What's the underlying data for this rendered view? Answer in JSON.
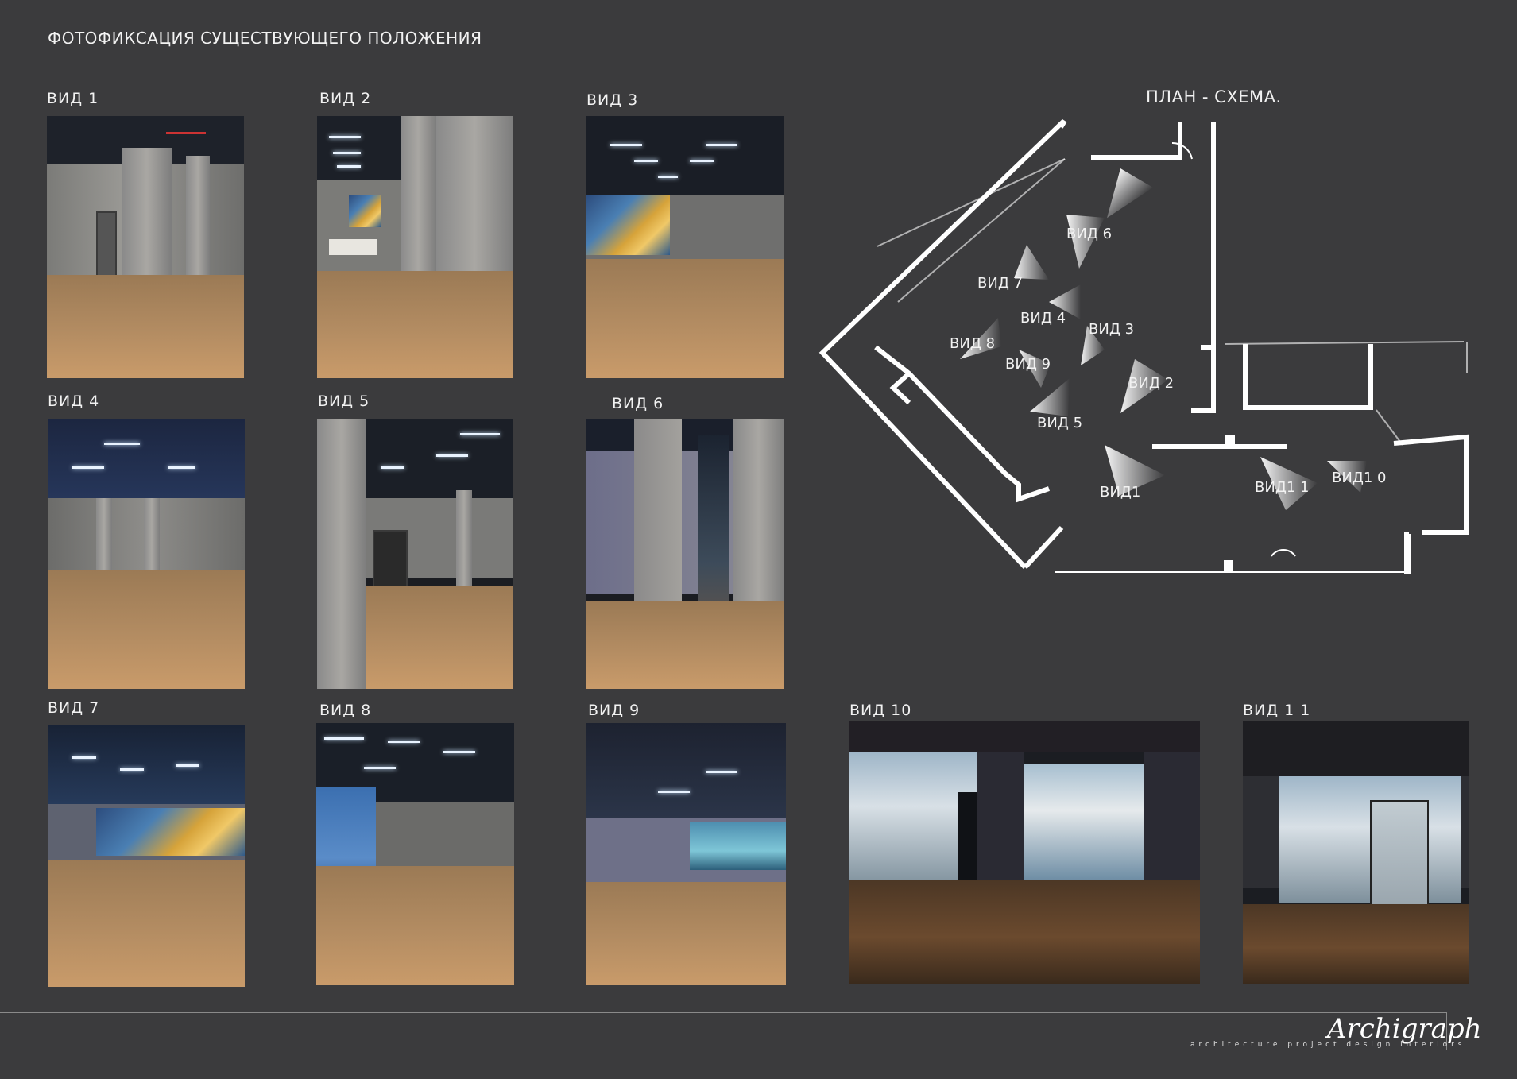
{
  "header": {
    "title": "ФОТОФИКСАЦИЯ СУЩЕСТВУЮЩЕГО ПОЛОЖЕНИЯ"
  },
  "plan": {
    "title": "ПЛАН - СХЕМА.",
    "views": [
      "ВИД 6",
      "ВИД 7",
      "ВИД 4",
      "ВИД 3",
      "ВИД 8",
      "ВИД 9",
      "ВИД 2",
      "ВИД 5",
      "ВИД1",
      "ВИД1 1",
      "ВИД1 0"
    ]
  },
  "photos": [
    {
      "caption": "ВИД 1"
    },
    {
      "caption": "ВИД 2"
    },
    {
      "caption": "ВИД 3"
    },
    {
      "caption": "ВИД 4"
    },
    {
      "caption": "ВИД 5"
    },
    {
      "caption": "ВИД 6"
    },
    {
      "caption": "ВИД 7"
    },
    {
      "caption": "ВИД 8"
    },
    {
      "caption": "ВИД 9"
    },
    {
      "caption": "ВИД 10"
    },
    {
      "caption": "ВИД 1 1"
    }
  ],
  "footer": {
    "logo": "Archigraph",
    "tagline": "architecture   project   design   interiors"
  }
}
